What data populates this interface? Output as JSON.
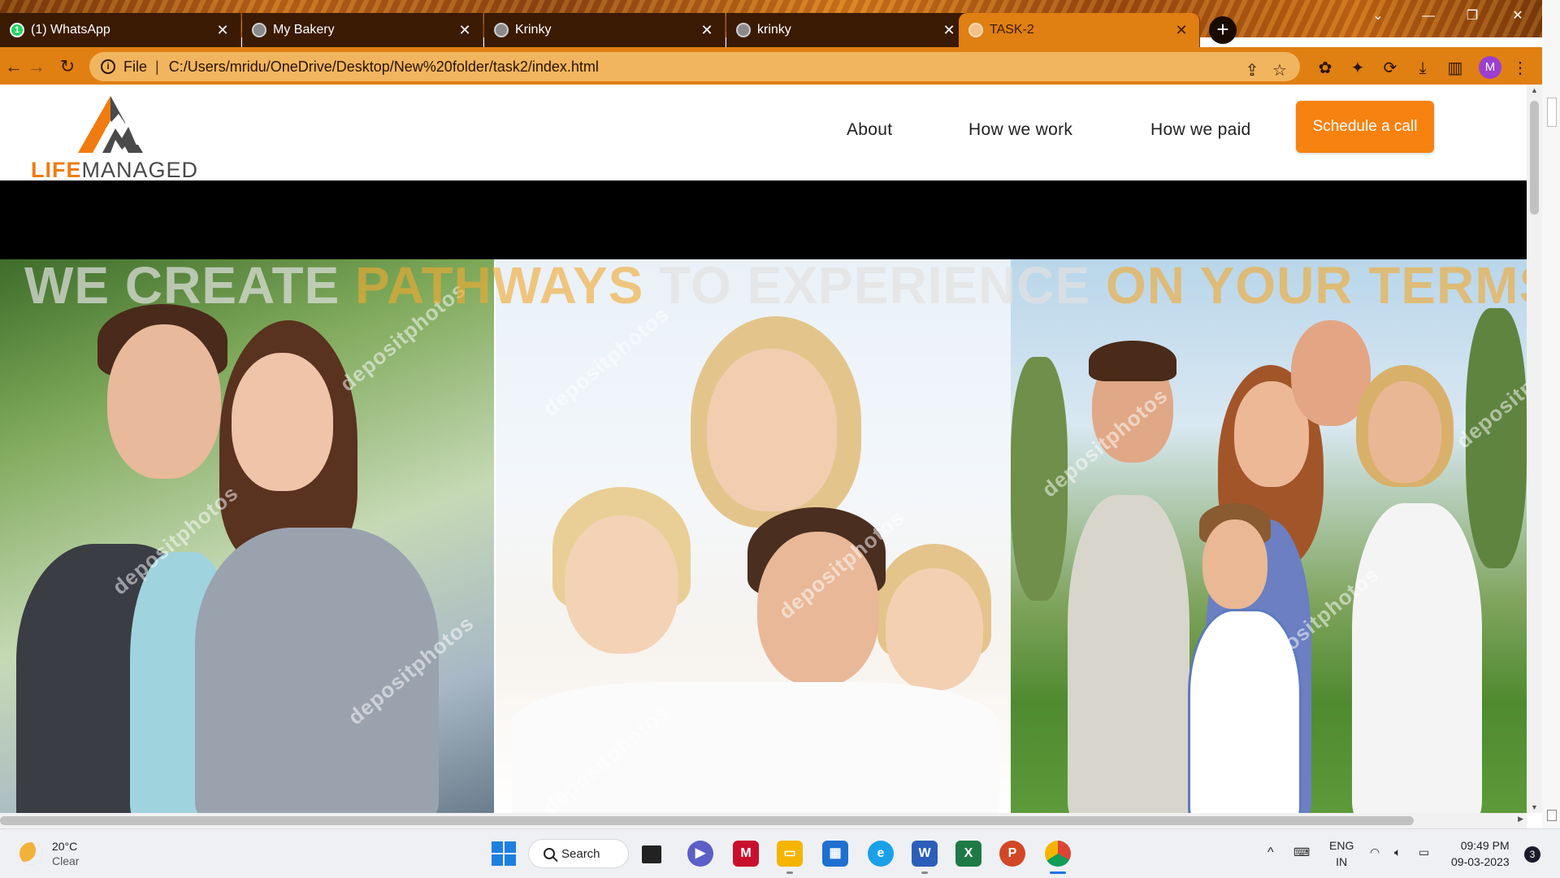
{
  "browser": {
    "tabs": [
      {
        "title": "(1) WhatsApp",
        "favicon": "whatsapp-icon",
        "badge": "1"
      },
      {
        "title": "My Bakery",
        "favicon": "globe-icon"
      },
      {
        "title": "Krinky",
        "favicon": "globe-icon"
      },
      {
        "title": "krinky",
        "favicon": "globe-icon"
      },
      {
        "title": "TASK-2",
        "favicon": "globe-icon",
        "active": true
      }
    ],
    "new_tab": "+",
    "close_glyph": "✕",
    "address": {
      "scheme_label": "File",
      "separator": "|",
      "url": "C:/Users/mridu/OneDrive/Desktop/New%20folder/task2/index.html"
    },
    "profile_initial": "M",
    "accent_color": "#e07f12"
  },
  "site": {
    "logo": {
      "part1": "LIFE",
      "part2": "MANAGED"
    },
    "nav": [
      "About",
      "How we work",
      "How we paid"
    ],
    "cta": "Schedule a call",
    "hero": {
      "heading_parts": [
        {
          "text": "WE CREATE ",
          "tone": "white"
        },
        {
          "text": "PATHWAYS ",
          "tone": "orange"
        },
        {
          "text": "TO EXPERIENCE ",
          "tone": "white"
        },
        {
          "text": "ON YOUR TERMS",
          "tone": "orange"
        }
      ],
      "watermark": "depositphotos"
    },
    "colors": {
      "brand_orange": "#f7820f",
      "logo_gray": "#4a4a4a"
    }
  },
  "taskbar": {
    "weather": {
      "temp": "20°C",
      "condition": "Clear"
    },
    "search": "Search",
    "apps": [
      "start",
      "search",
      "task-view",
      "teams",
      "mcafee",
      "file-explorer",
      "store",
      "edge",
      "word",
      "excel",
      "powerpoint",
      "chrome"
    ],
    "tray": {
      "language_top": "ENG",
      "language_bottom": "IN"
    },
    "clock": {
      "time": "09:49 PM",
      "date": "09-03-2023"
    },
    "notifications": "3"
  }
}
